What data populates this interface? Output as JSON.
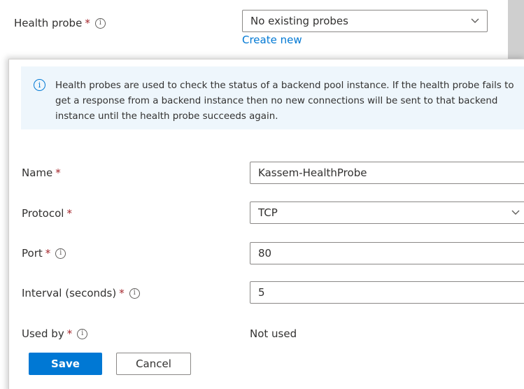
{
  "health_probe": {
    "label": "Health probe",
    "required_mark": "*",
    "selected": "No existing probes",
    "create_new_label": "Create new"
  },
  "info": {
    "message": "Health probes are used to check the status of a backend pool instance. If the health probe fails to get a response from a backend instance then no new connections will be sent to that backend instance until the health probe succeeds again."
  },
  "form": {
    "name": {
      "label": "Name",
      "required_mark": "*",
      "value": "Kassem-HealthProbe"
    },
    "protocol": {
      "label": "Protocol",
      "required_mark": "*",
      "value": "TCP"
    },
    "port": {
      "label": "Port",
      "required_mark": "*",
      "value": "80"
    },
    "interval": {
      "label": "Interval (seconds)",
      "required_mark": "*",
      "value": "5"
    },
    "used_by": {
      "label": "Used by",
      "required_mark": "*",
      "value": "Not used"
    }
  },
  "actions": {
    "save_label": "Save",
    "cancel_label": "Cancel"
  },
  "colors": {
    "accent": "#0078d4",
    "info_bg": "#eef6fc",
    "required": "#a4262c"
  }
}
